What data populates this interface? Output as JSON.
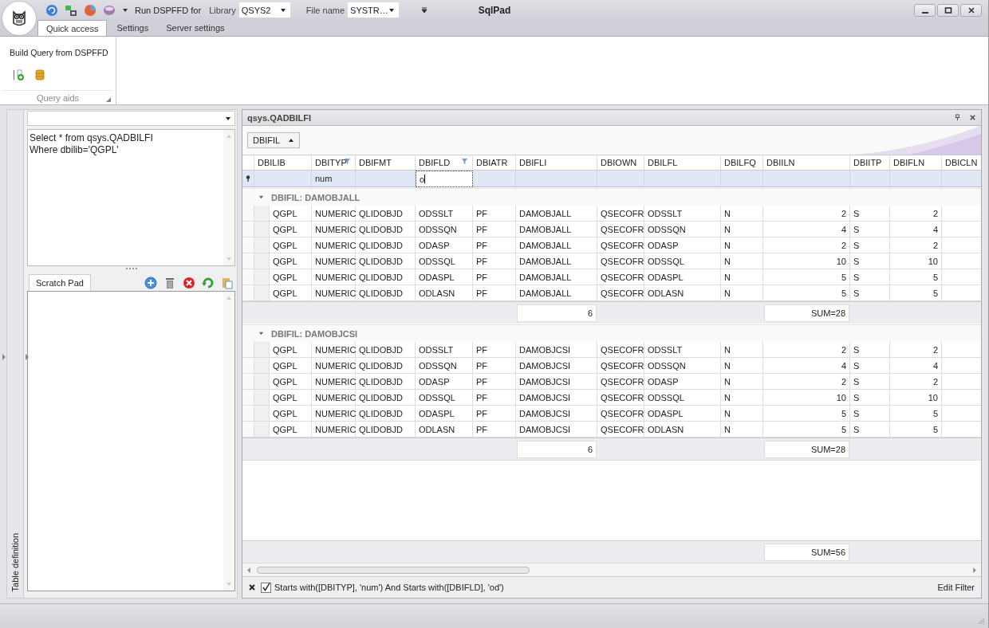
{
  "title_bar": {
    "title": "SqlPad",
    "run_label": "Run DSPFFD for",
    "library_label": "Library",
    "library_value": "QSYS2",
    "file_label": "File name",
    "file_value": "SYSTR…"
  },
  "ribbon": {
    "tabs": [
      {
        "label": "Quick access",
        "selected": true
      },
      {
        "label": "Settings",
        "selected": false
      },
      {
        "label": "Server settings",
        "selected": false
      }
    ],
    "group": {
      "title": "Build Query from DSPFFD",
      "caption": "Query aids"
    }
  },
  "side_panel": {
    "vertical_tab": "Table definition",
    "query_lines": [
      "Select * from qsys.QADBILFI",
      "Where dbilib='QGPL'"
    ],
    "scratch_tab": {
      "label": "Scratch Pad",
      "selected": true
    }
  },
  "grid": {
    "title": "qsys.QADBILFI",
    "group_by": "DBIFIL",
    "columns": [
      {
        "label": "DBILIB",
        "filtered": false,
        "numeric": false
      },
      {
        "label": "DBITYP",
        "filtered": true,
        "numeric": false,
        "filter": {
          "text": "num",
          "editing": false
        }
      },
      {
        "label": "DBIFMT",
        "filtered": false,
        "numeric": false
      },
      {
        "label": "DBIFLD",
        "filtered": true,
        "numeric": false,
        "filter": {
          "text": "o",
          "editing": true
        }
      },
      {
        "label": "DBIATR",
        "filtered": false,
        "numeric": false
      },
      {
        "label": "DBIFLI",
        "filtered": false,
        "numeric": false,
        "group_summaries": [
          "6",
          "6"
        ]
      },
      {
        "label": "DBIOWN",
        "filtered": false,
        "numeric": false
      },
      {
        "label": "DBILFL",
        "filtered": false,
        "numeric": false
      },
      {
        "label": "DBILFQ",
        "filtered": false,
        "numeric": false
      },
      {
        "label": "DBIILN",
        "filtered": false,
        "numeric": true,
        "group_summaries": [
          "SUM=28",
          "SUM=28"
        ],
        "total": "SUM=56"
      },
      {
        "label": "DBIITP",
        "filtered": false,
        "numeric": false
      },
      {
        "label": "DBIFLN",
        "filtered": false,
        "numeric": true
      },
      {
        "label": "DBICLN",
        "filtered": false,
        "numeric": false
      }
    ],
    "groups": [
      {
        "label": "DBIFIL: DAMOBJALL",
        "expanded": true,
        "rows": [
          [
            "QGPL",
            "NUMERIC",
            "QLIDOBJD",
            "ODSSLT",
            "PF",
            "DAMOBJALL",
            "QSECOFR",
            "ODSSLT",
            "N",
            "2",
            "S",
            "2"
          ],
          [
            "QGPL",
            "NUMERIC",
            "QLIDOBJD",
            "ODSSQN",
            "PF",
            "DAMOBJALL",
            "QSECOFR",
            "ODSSQN",
            "N",
            "4",
            "S",
            "4"
          ],
          [
            "QGPL",
            "NUMERIC",
            "QLIDOBJD",
            "ODASP",
            "PF",
            "DAMOBJALL",
            "QSECOFR",
            "ODASP",
            "N",
            "2",
            "S",
            "2"
          ],
          [
            "QGPL",
            "NUMERIC",
            "QLIDOBJD",
            "ODSSQL",
            "PF",
            "DAMOBJALL",
            "QSECOFR",
            "ODSSQL",
            "N",
            "10",
            "S",
            "10"
          ],
          [
            "QGPL",
            "NUMERIC",
            "QLIDOBJD",
            "ODASPL",
            "PF",
            "DAMOBJALL",
            "QSECOFR",
            "ODASPL",
            "N",
            "5",
            "S",
            "5"
          ],
          [
            "QGPL",
            "NUMERIC",
            "QLIDOBJD",
            "ODLASN",
            "PF",
            "DAMOBJALL",
            "QSECOFR",
            "ODLASN",
            "N",
            "5",
            "S",
            "5"
          ]
        ]
      },
      {
        "label": "DBIFIL: DAMOBJCSI",
        "expanded": true,
        "rows": [
          [
            "QGPL",
            "NUMERIC",
            "QLIDOBJD",
            "ODSSLT",
            "PF",
            "DAMOBJCSI",
            "QSECOFR",
            "ODSSLT",
            "N",
            "2",
            "S",
            "2"
          ],
          [
            "QGPL",
            "NUMERIC",
            "QLIDOBJD",
            "ODSSQN",
            "PF",
            "DAMOBJCSI",
            "QSECOFR",
            "ODSSQN",
            "N",
            "4",
            "S",
            "4"
          ],
          [
            "QGPL",
            "NUMERIC",
            "QLIDOBJD",
            "ODASP",
            "PF",
            "DAMOBJCSI",
            "QSECOFR",
            "ODASP",
            "N",
            "2",
            "S",
            "2"
          ],
          [
            "QGPL",
            "NUMERIC",
            "QLIDOBJD",
            "ODSSQL",
            "PF",
            "DAMOBJCSI",
            "QSECOFR",
            "ODSSQL",
            "N",
            "10",
            "S",
            "10"
          ],
          [
            "QGPL",
            "NUMERIC",
            "QLIDOBJD",
            "ODASPL",
            "PF",
            "DAMOBJCSI",
            "QSECOFR",
            "ODASPL",
            "N",
            "5",
            "S",
            "5"
          ],
          [
            "QGPL",
            "NUMERIC",
            "QLIDOBJD",
            "ODLASN",
            "PF",
            "DAMOBJCSI",
            "QSECOFR",
            "ODLASN",
            "N",
            "5",
            "S",
            "5"
          ]
        ]
      }
    ],
    "filter_bar": {
      "enabled": true,
      "expression": "Starts with([DBITYP], 'num') And Starts with([DBIFLD], 'od')",
      "edit_label": "Edit Filter"
    }
  }
}
